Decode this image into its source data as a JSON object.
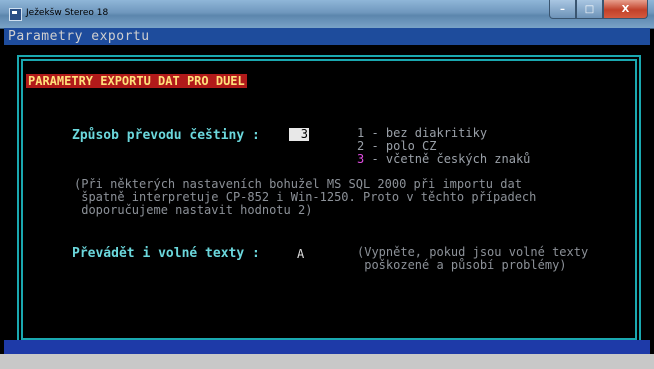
{
  "window": {
    "title": "Ježekšw Stereo 18",
    "buttons": {
      "minimize": "–",
      "maximize": "□",
      "close": "X"
    }
  },
  "console": {
    "header": "Parametry exportu",
    "heading": "PARAMETRY EXPORTU DAT PRO DUEL",
    "conversion": {
      "label": "Způsob převodu češtiny :",
      "value": "3",
      "options": [
        {
          "num": "1",
          "text": " - bez diakritiky",
          "selected": false
        },
        {
          "num": "2",
          "text": " - polo CZ",
          "selected": false
        },
        {
          "num": "3",
          "text": " - včetně českých znaků",
          "selected": true
        }
      ]
    },
    "note": "(Při některých nastaveních bohužel MS SQL 2000 při importu dat\n špatně interpretuje CP-852 i Win-1250. Proto v těchto případech\n doporučujeme nastavit hodnotu 2)",
    "free_texts": {
      "label": "Převádět i volné texty :",
      "value": "A",
      "hint": "(Vypněte, pokud jsou volné texty\n poškozené a působí problémy)"
    }
  },
  "colors": {
    "background": "#000000",
    "header_bar": "#1e4c9c",
    "heading_bg": "#b11a1a",
    "heading_fg": "#ffe07a",
    "label": "#6bd7dc",
    "selected_option": "#e04be0",
    "border": "#1aa8b0"
  }
}
